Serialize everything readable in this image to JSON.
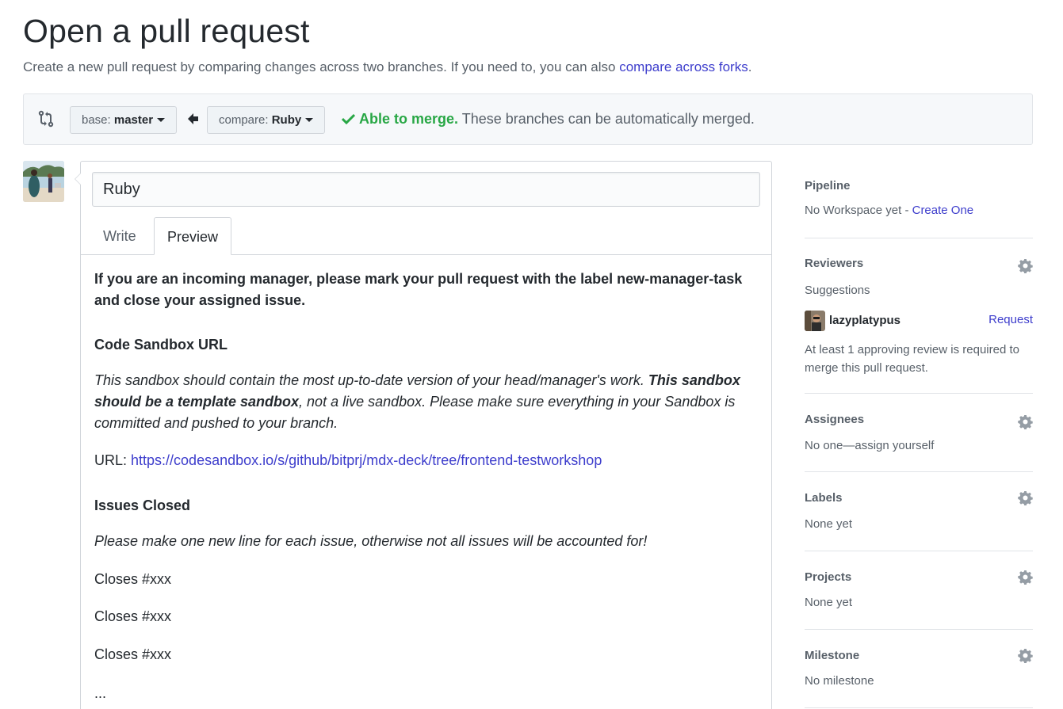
{
  "header": {
    "title": "Open a pull request",
    "subtitle": "Create a new pull request by comparing changes across two branches. If you need to, you can also ",
    "subtitle_link": "compare across forks",
    "subtitle_end": "."
  },
  "compare": {
    "base_prefix": "base: ",
    "base_branch": "master",
    "compare_prefix": "compare: ",
    "compare_branch": "Ruby",
    "merge_ok": "Able to merge.",
    "merge_text": " These branches can be automatically merged."
  },
  "form": {
    "title_value": "Ruby",
    "tabs": [
      {
        "label": "Write",
        "active": false
      },
      {
        "label": "Preview",
        "active": true
      }
    ],
    "preview": {
      "intro": "If you are an incoming manager, please mark your pull request with the label new-manager-task and close your assigned issue.",
      "sandbox_heading": "Code Sandbox URL",
      "sandbox_text_1": "This sandbox should contain the most up-to-date version of your head/manager's work. ",
      "sandbox_text_bold": "This sandbox should be a template sandbox",
      "sandbox_text_2": ", not a live sandbox. Please make sure everything in your Sandbox is committed and pushed to your branch.",
      "url_label": "URL: ",
      "url": "https://codesandbox.io/s/github/bitprj/mdx-deck/tree/frontend-testworkshop",
      "issues_heading": "Issues Closed",
      "issues_note": "Please make one new line for each issue, otherwise not all issues will be accounted for!",
      "closes": [
        "Closes #xxx",
        "Closes #xxx",
        "Closes #xxx"
      ],
      "ellipsis": "..."
    }
  },
  "sidebar": {
    "pipeline": {
      "heading": "Pipeline",
      "text": "No Workspace yet - ",
      "link": "Create One"
    },
    "reviewers": {
      "heading": "Reviewers",
      "suggestions_label": "Suggestions",
      "suggested_user": "lazyplatypus",
      "request_label": "Request",
      "note": "At least 1 approving review is required to merge this pull request."
    },
    "assignees": {
      "heading": "Assignees",
      "text": "No one—assign yourself"
    },
    "labels": {
      "heading": "Labels",
      "text": "None yet"
    },
    "projects": {
      "heading": "Projects",
      "text": "None yet"
    },
    "milestone": {
      "heading": "Milestone",
      "text": "No milestone"
    }
  },
  "colors": {
    "link": "#3d3dcc",
    "success": "#28a745",
    "muted": "#586069",
    "text": "#24292e"
  },
  "icons": [
    "git-compare-icon",
    "caret-down-icon",
    "arrow-left-icon",
    "check-icon",
    "gear-icon",
    "avatar"
  ]
}
